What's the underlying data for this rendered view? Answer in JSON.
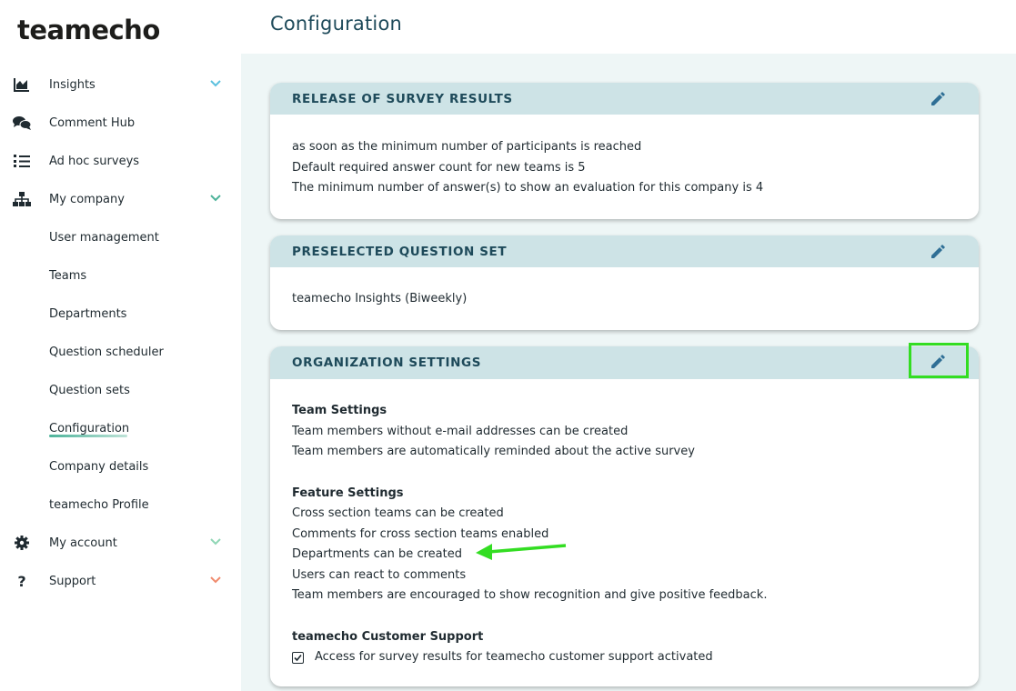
{
  "app": {
    "logo": "teamecho",
    "page_title": "Configuration"
  },
  "sidebar": {
    "items": [
      {
        "label": "Insights",
        "icon": "chart-area-icon",
        "chevron": "down",
        "chevron_color": "#5bc0de"
      },
      {
        "label": "Comment Hub",
        "icon": "comments-icon"
      },
      {
        "label": "Ad hoc surveys",
        "icon": "list-numbered-icon"
      },
      {
        "label": "My company",
        "icon": "sitemap-icon",
        "chevron": "down",
        "chevron_color": "#4db39a"
      },
      {
        "label": "My account",
        "icon": "gear-icon",
        "chevron": "down",
        "chevron_color": "#8fd6b5"
      },
      {
        "label": "Support",
        "icon": "question-icon",
        "chevron": "down",
        "chevron_color": "#f08a6c"
      }
    ],
    "company_subitems": [
      {
        "label": "User management"
      },
      {
        "label": "Teams"
      },
      {
        "label": "Departments"
      },
      {
        "label": "Question scheduler"
      },
      {
        "label": "Question sets"
      },
      {
        "label": "Configuration",
        "active": true
      },
      {
        "label": "Company details"
      },
      {
        "label": "teamecho Profile"
      }
    ]
  },
  "cards": {
    "release": {
      "title": "RELEASE OF SURVEY RESULTS",
      "lines": [
        "as soon as the minimum number of participants is reached",
        "Default required answer count for new teams is 5",
        "The minimum number of answer(s) to show an evaluation for this company is 4"
      ]
    },
    "question_set": {
      "title": "PRESELECTED QUESTION SET",
      "lines": [
        "teamecho Insights (Biweekly)"
      ]
    },
    "organization": {
      "title": "ORGANIZATION SETTINGS",
      "team_settings": {
        "heading": "Team Settings",
        "lines": [
          "Team members without e-mail addresses can be created",
          "Team members are automatically reminded about the active survey"
        ]
      },
      "feature_settings": {
        "heading": "Feature Settings",
        "lines": [
          "Cross section teams can be created",
          "Comments for cross section teams enabled",
          "Departments can be created",
          "Users can react to comments",
          "Team members are encouraged to show recognition and give positive feedback."
        ]
      },
      "support": {
        "heading": "teamecho Customer Support",
        "checkbox_label": "Access for survey results for teamecho customer support activated",
        "checked": true
      }
    }
  },
  "colors": {
    "accent_dark": "#1e4a5a",
    "card_header": "#cde3e6",
    "annotation_green": "#33dd22",
    "page_bg": "#eef6f6"
  }
}
